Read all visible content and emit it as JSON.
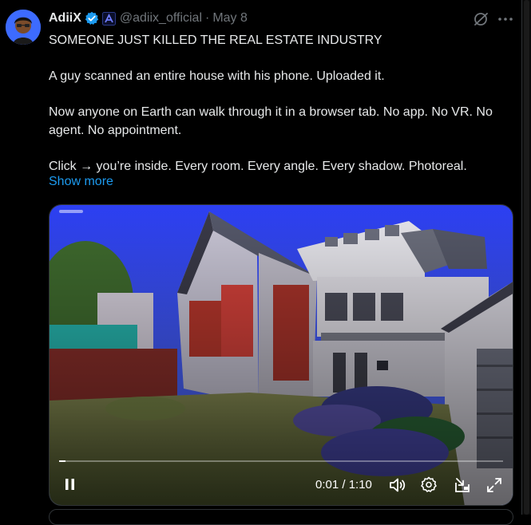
{
  "post": {
    "author_name": "AdiiX",
    "handle": "@adiix_official",
    "separator": "·",
    "date": "May 8",
    "paragraphs": [
      "SOMEONE JUST KILLED THE REAL ESTATE INDUSTRY",
      "A guy scanned an entire house with his phone. Uploaded it.",
      "Now anyone on Earth can walk through it in a browser tab. No app. No VR. No agent. No appointment.",
      "Click → you’re inside. Every room. Every angle. Every shadow. Photoreal."
    ],
    "show_more": "Show more"
  },
  "video": {
    "time": "0:01 / 1:10",
    "progress": 0.014
  },
  "icons": {
    "verified": "verified-badge-icon",
    "affiliate": "affiliate-badge-icon",
    "grok": "grok-icon",
    "more": "more-icon",
    "pause": "pause-icon",
    "volume": "volume-icon",
    "settings": "settings-icon",
    "dock": "dock-icon",
    "fullscreen": "fullscreen-icon"
  },
  "colors": {
    "background": "#000000",
    "text": "#e7e9ea",
    "secondary": "#71767b",
    "link": "#1d9bf0",
    "verified": "#1d9bf0"
  }
}
